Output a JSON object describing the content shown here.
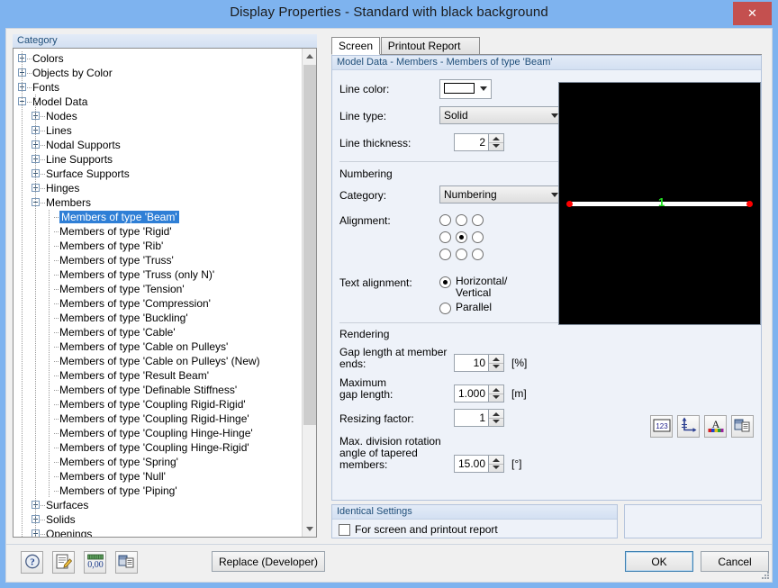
{
  "window": {
    "title": "Display Properties - Standard with black background",
    "close_label": "✕"
  },
  "left_panel": {
    "header": "Category",
    "tree": [
      {
        "label": "Colors",
        "depth": 0,
        "expander": "col"
      },
      {
        "label": "Objects by Color",
        "depth": 0,
        "expander": "col"
      },
      {
        "label": "Fonts",
        "depth": 0,
        "expander": "col"
      },
      {
        "label": "Model Data",
        "depth": 0,
        "expander": "exp"
      },
      {
        "label": "Nodes",
        "depth": 1,
        "expander": "col"
      },
      {
        "label": "Lines",
        "depth": 1,
        "expander": "col"
      },
      {
        "label": "Nodal Supports",
        "depth": 1,
        "expander": "col"
      },
      {
        "label": "Line Supports",
        "depth": 1,
        "expander": "col"
      },
      {
        "label": "Surface Supports",
        "depth": 1,
        "expander": "col"
      },
      {
        "label": "Hinges",
        "depth": 1,
        "expander": "col"
      },
      {
        "label": "Members",
        "depth": 1,
        "expander": "exp"
      },
      {
        "label": "Members of type 'Beam'",
        "depth": 2,
        "expander": "none",
        "selected": true
      },
      {
        "label": "Members of type 'Rigid'",
        "depth": 2,
        "expander": "none"
      },
      {
        "label": "Members of type 'Rib'",
        "depth": 2,
        "expander": "none"
      },
      {
        "label": "Members of type 'Truss'",
        "depth": 2,
        "expander": "none"
      },
      {
        "label": "Members of type 'Truss (only N)'",
        "depth": 2,
        "expander": "none"
      },
      {
        "label": "Members of type 'Tension'",
        "depth": 2,
        "expander": "none"
      },
      {
        "label": "Members of type 'Compression'",
        "depth": 2,
        "expander": "none"
      },
      {
        "label": "Members of type 'Buckling'",
        "depth": 2,
        "expander": "none"
      },
      {
        "label": "Members of type 'Cable'",
        "depth": 2,
        "expander": "none"
      },
      {
        "label": "Members of type 'Cable on Pulleys'",
        "depth": 2,
        "expander": "none"
      },
      {
        "label": "Members of type 'Cable on Pulleys'  (New)",
        "depth": 2,
        "expander": "none"
      },
      {
        "label": "Members of type 'Result Beam'",
        "depth": 2,
        "expander": "none"
      },
      {
        "label": "Members of type 'Definable Stiffness'",
        "depth": 2,
        "expander": "none"
      },
      {
        "label": "Members of type 'Coupling Rigid-Rigid'",
        "depth": 2,
        "expander": "none"
      },
      {
        "label": "Members of type 'Coupling Rigid-Hinge'",
        "depth": 2,
        "expander": "none"
      },
      {
        "label": "Members of type 'Coupling Hinge-Hinge'",
        "depth": 2,
        "expander": "none"
      },
      {
        "label": "Members of type 'Coupling Hinge-Rigid'",
        "depth": 2,
        "expander": "none"
      },
      {
        "label": "Members of type 'Spring'",
        "depth": 2,
        "expander": "none"
      },
      {
        "label": "Members of type 'Null'",
        "depth": 2,
        "expander": "none"
      },
      {
        "label": "Members of type 'Piping'",
        "depth": 2,
        "expander": "none"
      },
      {
        "label": "Surfaces",
        "depth": 1,
        "expander": "col"
      },
      {
        "label": "Solids",
        "depth": 1,
        "expander": "col"
      },
      {
        "label": "Openings",
        "depth": 1,
        "expander": "col"
      }
    ]
  },
  "tabs": [
    {
      "label": "Screen",
      "active": true
    },
    {
      "label": "Printout Report",
      "active": false
    }
  ],
  "model_group": {
    "header": "Model Data - Members - Members of type 'Beam'",
    "line_color_label": "Line color:",
    "line_color_value": "#ffffff",
    "line_type_label": "Line type:",
    "line_type_value": "Solid",
    "line_thickness_label": "Line thickness:",
    "line_thickness_value": "2",
    "numbering_title": "Numbering",
    "category_label": "Category:",
    "category_value": "Numbering",
    "alignment_label": "Alignment:",
    "alignment_selected_index": 4,
    "text_alignment_label": "Text alignment:",
    "text_alignment_options": [
      {
        "label_line1": "Horizontal/",
        "label_line2": "Vertical",
        "selected": true
      },
      {
        "label_line1": "Parallel",
        "label_line2": "",
        "selected": false
      }
    ],
    "rendering_title": "Rendering",
    "gap_label_line1": "Gap length at member",
    "gap_label_line2": "ends:",
    "gap_value": "10",
    "gap_unit": "[%]",
    "maxgap_label_line1": "Maximum",
    "maxgap_label_line2": "gap length:",
    "maxgap_value": "1.000",
    "maxgap_unit": "[m]",
    "resize_label": "Resizing factor:",
    "resize_value": "1",
    "maxrot_label_line1": "Max. division rotation",
    "maxrot_label_line2": "angle of tapered",
    "maxrot_label_line3": "members:",
    "maxrot_value": "15.00",
    "maxrot_unit": "[°]"
  },
  "preview": {
    "member_number": "1",
    "line_color": "#ffffff",
    "node_color": "#ff0000",
    "number_color": "#23e223",
    "background": "#000000"
  },
  "preview_toolbar": [
    {
      "name": "numbering-icon",
      "label": "123"
    },
    {
      "name": "axis-icon",
      "label": ""
    },
    {
      "name": "font-color-icon",
      "label": "A"
    },
    {
      "name": "display-properties-icon",
      "label": ""
    }
  ],
  "identical_settings": {
    "header": "Identical Settings",
    "checkbox_label": "For screen and printout report",
    "checked": false
  },
  "footer": {
    "toolbar": [
      {
        "name": "help-icon",
        "label": "?"
      },
      {
        "name": "edit-icon",
        "label": ""
      },
      {
        "name": "number-format-icon",
        "label": "0,00"
      },
      {
        "name": "copy-icon",
        "label": ""
      }
    ],
    "replace_label": "Replace (Developer)",
    "ok_label": "OK",
    "cancel_label": "Cancel"
  }
}
